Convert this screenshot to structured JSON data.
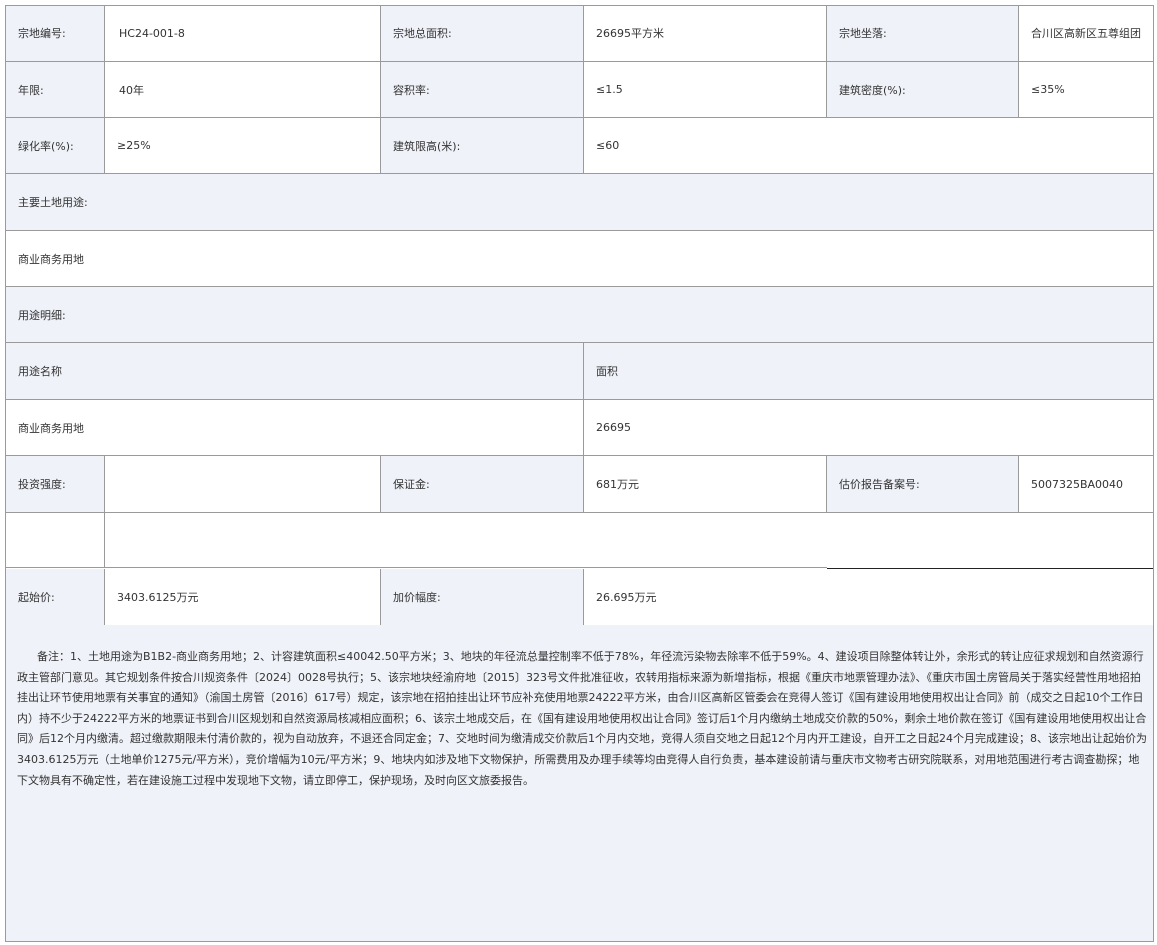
{
  "rows": {
    "r1": {
      "l1": "宗地编号:",
      "v1": "HC24-001-8",
      "l2": "宗地总面积:",
      "v2": "26695平方米",
      "l3": "宗地坐落:",
      "v3": "合川区高新区五尊组团"
    },
    "r2": {
      "l1": "年限:",
      "v1": "40年",
      "l2": "容积率:",
      "v2": "≤1.5",
      "l3": "建筑密度(%):",
      "v3": "≤35%"
    },
    "r3": {
      "l1": "绿化率(%):",
      "v1": "≥25%",
      "l2": "建筑限高(米):",
      "v2": "≤60"
    },
    "r4": {
      "l1": "主要土地用途:"
    },
    "r5": {
      "v1": "商业商务用地"
    },
    "r6": {
      "l1": "用途明细:"
    },
    "r7": {
      "h1": "用途名称",
      "h2": "面积"
    },
    "r8": {
      "v1": "商业商务用地",
      "v2": "26695"
    },
    "r9": {
      "l1": "投资强度:",
      "v1": "",
      "l2": "保证金:",
      "v2": "681万元",
      "l3": "估价报告备案号:",
      "v3": "5007325BA0040"
    },
    "r11": {
      "l1": "起始价:",
      "v1": "3403.6125万元",
      "l2": "加价幅度:",
      "v2": "26.695万元"
    }
  },
  "note": "备注：1、土地用途为B1B2-商业商务用地；2、计容建筑面积≤40042.50平方米；3、地块的年径流总量控制率不低于78%，年径流污染物去除率不低于59%。4、建设项目除整体转让外，余形式的转让应征求规划和自然资源行政主管部门意见。其它规划条件按合川规资条件〔2024〕0028号执行；5、该宗地块经渝府地〔2015〕323号文件批准征收，农转用指标来源为新增指标，根据《重庆市地票管理办法》、《重庆市国土房管局关于落实经营性用地招拍挂出让环节使用地票有关事宜的通知》（渝国土房管〔2016〕617号）规定，该宗地在招拍挂出让环节应补充使用地票24222平方米，由合川区高新区管委会在竞得人签订《国有建设用地使用权出让合同》前（成交之日起10个工作日内）持不少于24222平方米的地票证书到合川区规划和自然资源局核减相应面积；6、该宗土地成交后，在《国有建设用地使用权出让合同》签订后1个月内缴纳土地成交价款的50%，剩余土地价款在签订《国有建设用地使用权出让合同》后12个月内缴清。超过缴款期限未付清价款的，视为自动放弃，不退还合同定金；7、交地时间为缴清成交价款后1个月内交地，竞得人须自交地之日起12个月内开工建设，自开工之日起24个月完成建设；8、该宗地出让起始价为3403.6125万元（土地单价1275元/平方米），竞价增幅为10元/平方米；9、地块内如涉及地下文物保护，所需费用及办理手续等均由竞得人自行负责，基本建设前请与重庆市文物考古研究院联系，对用地范围进行考古调查勘探；地下文物具有不确定性，若在建设施工过程中发现地下文物，请立即停工，保护现场，及时向区文旅委报告。"
}
